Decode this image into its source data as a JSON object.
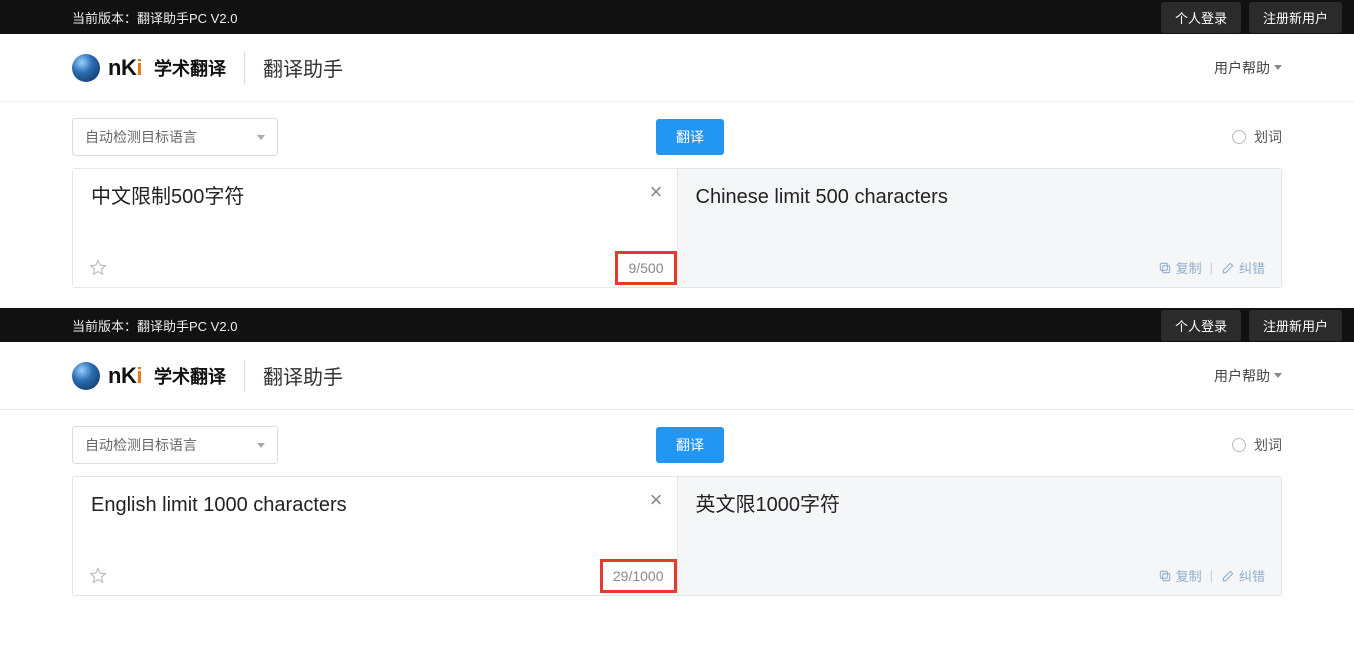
{
  "common": {
    "version_prefix": "当前版本：",
    "version_value": "翻译助手PC V2.0",
    "login_btn": "个人登录",
    "register_btn": "注册新用户",
    "logo_main_a": "n",
    "logo_main_b": "K",
    "logo_main_c": "i",
    "logo_sub": "学术翻译",
    "app_title": "翻译助手",
    "user_help": "用户帮助",
    "lang_detect": "自动检测目标语言",
    "translate_btn": "翻译",
    "selection_word": "划词",
    "copy_label": "复制",
    "correct_label": "纠错"
  },
  "blocks": [
    {
      "input_text": "中文限制500字符",
      "output_text": "Chinese limit 500 characters",
      "counter": "9/500"
    },
    {
      "input_text": "English limit 1000 characters",
      "output_text": "英文限1000字符",
      "counter": "29/1000"
    }
  ]
}
